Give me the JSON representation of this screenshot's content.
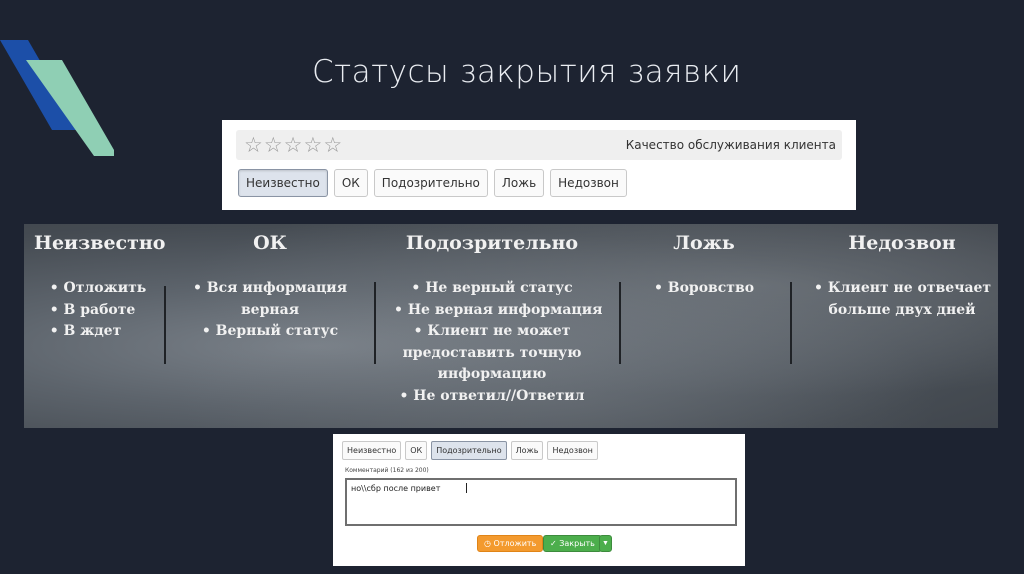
{
  "slide": {
    "title": "Статусы закрытия заявки",
    "colors": {
      "background": "#1d2331",
      "accent_blue": "#1c4fa8",
      "accent_green": "#8fcfb4"
    }
  },
  "top_panel": {
    "stars": [
      "☆",
      "☆",
      "☆",
      "☆",
      "☆"
    ],
    "rating_label": "Качество обслуживания клиента",
    "tabs": [
      {
        "label": "Неизвестно",
        "active": true
      },
      {
        "label": "ОК",
        "active": false
      },
      {
        "label": "Подозрительно",
        "active": false
      },
      {
        "label": "Ложь",
        "active": false
      },
      {
        "label": "Недозвон",
        "active": false
      }
    ]
  },
  "statuses": [
    {
      "title": "Неизвестно",
      "items": [
        "• Отложить",
        "• В работе",
        "• В ждет"
      ]
    },
    {
      "title": "ОК",
      "items": [
        "• Вся информация",
        "верная",
        "• Верный статус"
      ]
    },
    {
      "title": "Подозрительно",
      "items": [
        "• Не верный статус",
        "• Не верная информация",
        "• Клиент не может",
        "предоставить точную",
        "информацию",
        "• Не ответил//Ответил"
      ]
    },
    {
      "title": "Ложь",
      "items": [
        "• Воровство"
      ]
    },
    {
      "title": "Недозвон",
      "items": [
        "• Клиент не отвечает",
        "больше двух дней"
      ]
    }
  ],
  "bottom_panel": {
    "tabs": [
      {
        "label": "Неизвестно",
        "active": false
      },
      {
        "label": "ОК",
        "active": false
      },
      {
        "label": "Подозрительно",
        "active": true
      },
      {
        "label": "Ложь",
        "active": false
      },
      {
        "label": "Недозвон",
        "active": false
      }
    ],
    "comment_label": "Комментарий (162 из 200)",
    "comment_value": "но\\\\сбр после привет",
    "postpone_button": "Отложить",
    "close_button": "Закрыть",
    "postpone_icon": "clock-icon",
    "close_icon": "check-circle-icon",
    "dropdown_icon": "caret-down-icon"
  }
}
